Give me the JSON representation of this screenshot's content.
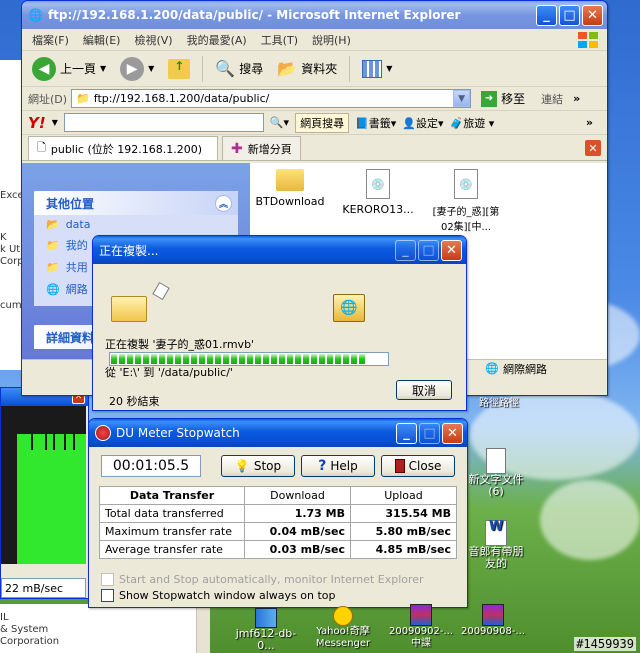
{
  "ie": {
    "title": "ftp://192.168.1.200/data/public/ - Microsoft Internet Explorer",
    "menu": [
      "檔案(F)",
      "編輯(E)",
      "檢視(V)",
      "我的最愛(A)",
      "工具(T)",
      "說明(H)"
    ],
    "toolbar": {
      "back": "上一頁",
      "search": "搜尋",
      "folders": "資料夾"
    },
    "address": {
      "label": "網址(D)",
      "value": "ftp://192.168.1.200/data/public/",
      "go": "移至",
      "links": "連結"
    },
    "yahoo": {
      "search_button": "網頁搜尋",
      "bookmarks": "書籤",
      "settings": "設定",
      "travel": "旅遊"
    },
    "tabs": {
      "active": "public (位於 192.168.1.200)",
      "new_tab": "新增分頁"
    },
    "sidebar": {
      "other_places": "其他位置",
      "items": [
        "data",
        "我的",
        "共用",
        "網路"
      ],
      "details": "詳細資料"
    },
    "files": [
      "BTDownload",
      "KERORO13...",
      "[妻子的_惑][第02集][中..."
    ],
    "status": "網際網路"
  },
  "copy_dialog": {
    "title": "正在複製...",
    "copying": "正在複製 '妻子的_惑01.rmvb'",
    "from_to": "從 'E:\\' 到 '/data/public/'",
    "progress": 0.55,
    "remaining": "20 秒結束",
    "cancel": "取消"
  },
  "du_meter": {
    "title": "DU Meter Stopwatch",
    "elapsed": "00:01:05.5",
    "buttons": {
      "stop": "Stop",
      "help": "Help",
      "close": "Close"
    },
    "table": {
      "headers": [
        "Data Transfer",
        "Download",
        "Upload"
      ],
      "rows": [
        {
          "label": "Total data transferred",
          "download": "1.73 MB",
          "upload": "315.54 MB"
        },
        {
          "label": "Maximum transfer rate",
          "download": "0.04 mB/sec",
          "upload": "5.80 mB/sec"
        },
        {
          "label": "Average transfer rate",
          "download": "0.03 mB/sec",
          "upload": "4.85 mB/sec"
        }
      ]
    },
    "auto_monitor": "Start and Stop automatically, monitor Internet Explorer",
    "always_on_top": "Show Stopwatch window always on top"
  },
  "left_graph": {
    "rate": "22 mB/sec"
  },
  "left_text": {
    "lines": [
      "Exce",
      "K",
      "k Ut",
      "Corp",
      "cum"
    ],
    "bottom_lines": [
      "IL",
      "& System",
      "Corporation"
    ]
  },
  "desktop": {
    "icons_right": [
      "路徑路徑",
      "新文字文件 (6)",
      "音郎有帶朋友的"
    ],
    "icons_bottom": [
      "jmf612-db-0...",
      "Yahoo!奇摩 Messenger",
      "20090902-...中諜",
      "20090908-..."
    ]
  },
  "watermark": "#1459939",
  "colors": {
    "title_blue": "#0650d4",
    "progress_green": "#29c319",
    "graph_green": "#31e82f"
  }
}
